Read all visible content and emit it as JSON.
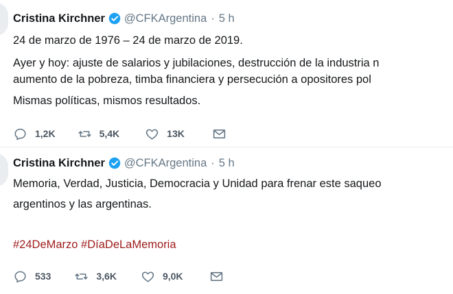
{
  "tweets": [
    {
      "name": "Cristina Kirchner",
      "handle": "@CFKArgentina",
      "separator": "·",
      "time": "5 h",
      "lines": [
        "24 de marzo de 1976 – 24 de marzo de 2019.",
        "Ayer y hoy: ajuste de salarios y jubilaciones, destrucción de la industria n",
        "aumento de la pobreza, timba financiera y persecución a opositores pol",
        "Mismas políticas, mismos resultados."
      ],
      "hashtags": "",
      "actions": {
        "reply_count": "1,2K",
        "retweet_count": "5,4K",
        "like_count": "13K"
      }
    },
    {
      "name": "Cristina Kirchner",
      "handle": "@CFKArgentina",
      "separator": "·",
      "time": "5 h",
      "lines": [
        "Memoria, Verdad, Justicia, Democracia y Unidad para frenar este saqueo",
        "argentinos y las argentinas."
      ],
      "hashtags": "#24DeMarzo #DíaDeLaMemoria",
      "actions": {
        "reply_count": "533",
        "retweet_count": "3,6K",
        "like_count": "9,0K"
      }
    }
  ],
  "icons": {
    "verified": "verified-badge-icon",
    "reply": "reply-icon",
    "retweet": "retweet-icon",
    "like": "heart-icon",
    "dm": "envelope-icon"
  },
  "colors": {
    "verified": "#1da1f2",
    "hashtag": "#9e1a1a",
    "meta": "#657786",
    "text": "#14171a"
  }
}
